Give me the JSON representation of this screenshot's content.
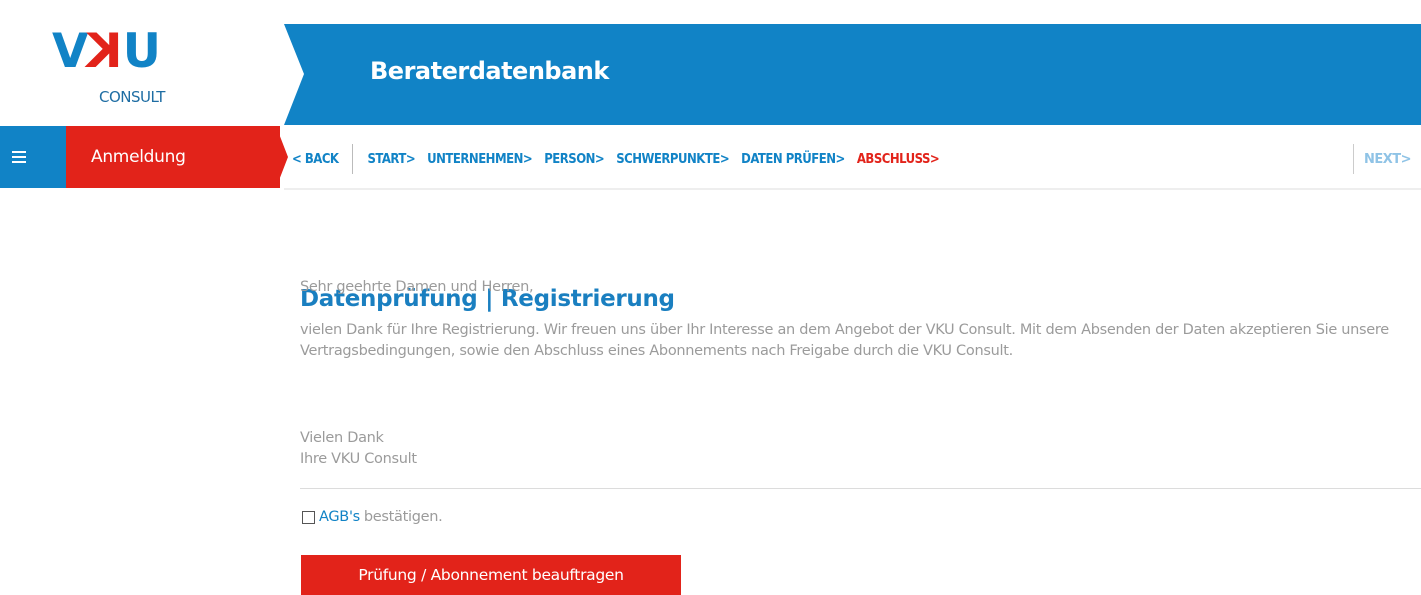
{
  "logo": {
    "mark_v": "V",
    "mark_k": "K",
    "mark_u": "U",
    "sub": "CONSULT"
  },
  "banner": {
    "title": "Beraterdatenbank"
  },
  "sidebar": {
    "menu_icon": "hamburger-icon",
    "active_item": "Anmeldung"
  },
  "nav": {
    "back": "< BACK",
    "steps": [
      {
        "label": "START>",
        "active": false
      },
      {
        "label": "UNTERNEHMEN>",
        "active": false
      },
      {
        "label": "PERSON>",
        "active": false
      },
      {
        "label": "SCHWERPUNKTE>",
        "active": false
      },
      {
        "label": "DATEN PRÜFEN>",
        "active": false
      },
      {
        "label": "ABSCHLUSS>",
        "active": true
      }
    ],
    "next": "NEXT>"
  },
  "content": {
    "heading": "Datenprüfung | Registrierung",
    "salutation": "Sehr geehrte Damen und Herren,",
    "paragraph": "vielen Dank für Ihre Registrierung. Wir freuen uns über Ihr Interesse an dem Angebot der VKU Consult. Mit dem Absenden der Daten akzeptieren Sie unsere Vertragsbedingungen, sowie den Abschluss eines Abonnements nach Freigabe durch die VKU Consult.",
    "closing_line1": "Vielen Dank",
    "closing_line2": "Ihre VKU Consult"
  },
  "agb": {
    "checked": false,
    "link_label": "AGB's",
    "text": "bestätigen."
  },
  "submit": {
    "label": "Prüfung / Abonnement beauftragen"
  },
  "colors": {
    "blue": "#1183c6",
    "red": "#e2231a",
    "text_grey": "#9b9b9b"
  }
}
